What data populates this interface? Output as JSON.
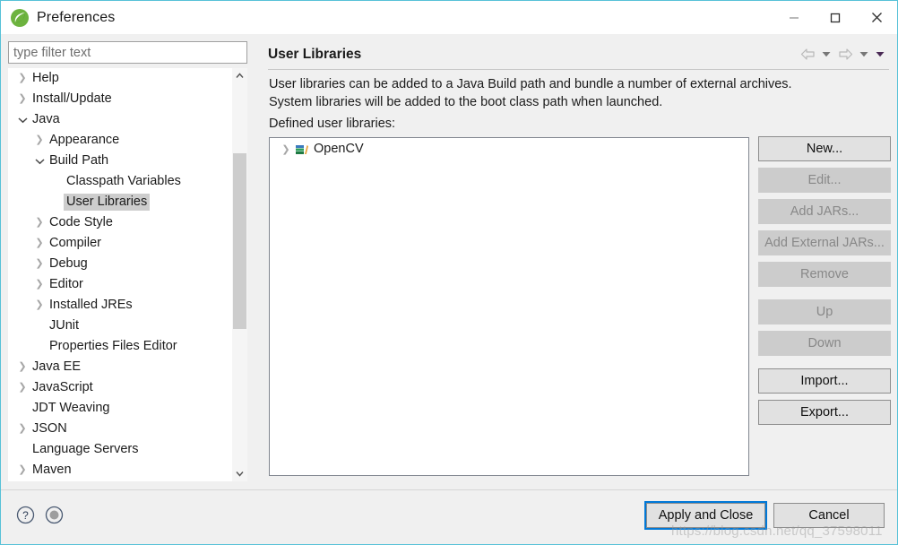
{
  "window": {
    "title": "Preferences",
    "logo_icon": "spring-leaf-icon",
    "minimize_icon": "minimize-icon",
    "maximize_icon": "maximize-icon",
    "close_icon": "close-icon",
    "accent_border": "#57c1d8"
  },
  "filter": {
    "placeholder": "type filter text",
    "value": ""
  },
  "tree": {
    "items": [
      {
        "label": "Help",
        "indent": 0,
        "state": "collapsed",
        "selected": false
      },
      {
        "label": "Install/Update",
        "indent": 0,
        "state": "collapsed",
        "selected": false
      },
      {
        "label": "Java",
        "indent": 0,
        "state": "expanded",
        "selected": false
      },
      {
        "label": "Appearance",
        "indent": 1,
        "state": "collapsed",
        "selected": false
      },
      {
        "label": "Build Path",
        "indent": 1,
        "state": "expanded",
        "selected": false
      },
      {
        "label": "Classpath Variables",
        "indent": 2,
        "state": "leaf",
        "selected": false
      },
      {
        "label": "User Libraries",
        "indent": 2,
        "state": "leaf",
        "selected": true
      },
      {
        "label": "Code Style",
        "indent": 1,
        "state": "collapsed",
        "selected": false
      },
      {
        "label": "Compiler",
        "indent": 1,
        "state": "collapsed",
        "selected": false
      },
      {
        "label": "Debug",
        "indent": 1,
        "state": "collapsed",
        "selected": false
      },
      {
        "label": "Editor",
        "indent": 1,
        "state": "collapsed",
        "selected": false
      },
      {
        "label": "Installed JREs",
        "indent": 1,
        "state": "collapsed",
        "selected": false
      },
      {
        "label": "JUnit",
        "indent": 1,
        "state": "leaf",
        "selected": false
      },
      {
        "label": "Properties Files Editor",
        "indent": 1,
        "state": "leaf",
        "selected": false
      },
      {
        "label": "Java EE",
        "indent": 0,
        "state": "collapsed",
        "selected": false
      },
      {
        "label": "JavaScript",
        "indent": 0,
        "state": "collapsed",
        "selected": false
      },
      {
        "label": "JDT Weaving",
        "indent": 0,
        "state": "leaf",
        "selected": false
      },
      {
        "label": "JSON",
        "indent": 0,
        "state": "collapsed",
        "selected": false
      },
      {
        "label": "Language Servers",
        "indent": 0,
        "state": "leaf",
        "selected": false
      },
      {
        "label": "Maven",
        "indent": 0,
        "state": "collapsed",
        "selected": false
      }
    ],
    "scrollbar": {
      "up_icon": "chevron-up-icon",
      "down_icon": "chevron-down-icon"
    }
  },
  "page": {
    "title": "User Libraries",
    "nav": {
      "back_icon": "back-arrow-icon",
      "back_menu_icon": "chevron-down-icon",
      "forward_icon": "forward-arrow-icon",
      "forward_menu_icon": "chevron-down-icon",
      "view_menu_icon": "chevron-down-icon"
    },
    "description_line1": "User libraries can be added to a Java Build path and bundle a number of external archives.",
    "description_line2": "System libraries will be added to the boot class path when launched.",
    "list_label": "Defined user libraries:",
    "libraries": [
      {
        "name": "OpenCV",
        "state": "collapsed",
        "icon": "library-stack-icon"
      }
    ],
    "buttons": [
      {
        "label": "New...",
        "enabled": true,
        "gap": false
      },
      {
        "label": "Edit...",
        "enabled": false,
        "gap": false
      },
      {
        "label": "Add JARs...",
        "enabled": false,
        "gap": false
      },
      {
        "label": "Add External JARs...",
        "enabled": false,
        "gap": false
      },
      {
        "label": "Remove",
        "enabled": false,
        "gap": false
      },
      {
        "label": "Up",
        "enabled": false,
        "gap": true
      },
      {
        "label": "Down",
        "enabled": false,
        "gap": false
      },
      {
        "label": "Import...",
        "enabled": true,
        "gap": true
      },
      {
        "label": "Export...",
        "enabled": true,
        "gap": false
      }
    ]
  },
  "footer": {
    "help_icon": "help-question-icon",
    "dot_icon": "circle-dot-icon",
    "apply_and_close_label": "Apply and Close",
    "cancel_label": "Cancel",
    "focus_color": "#0078d7",
    "watermark": "https://blog.csdn.net/qq_37598011"
  }
}
